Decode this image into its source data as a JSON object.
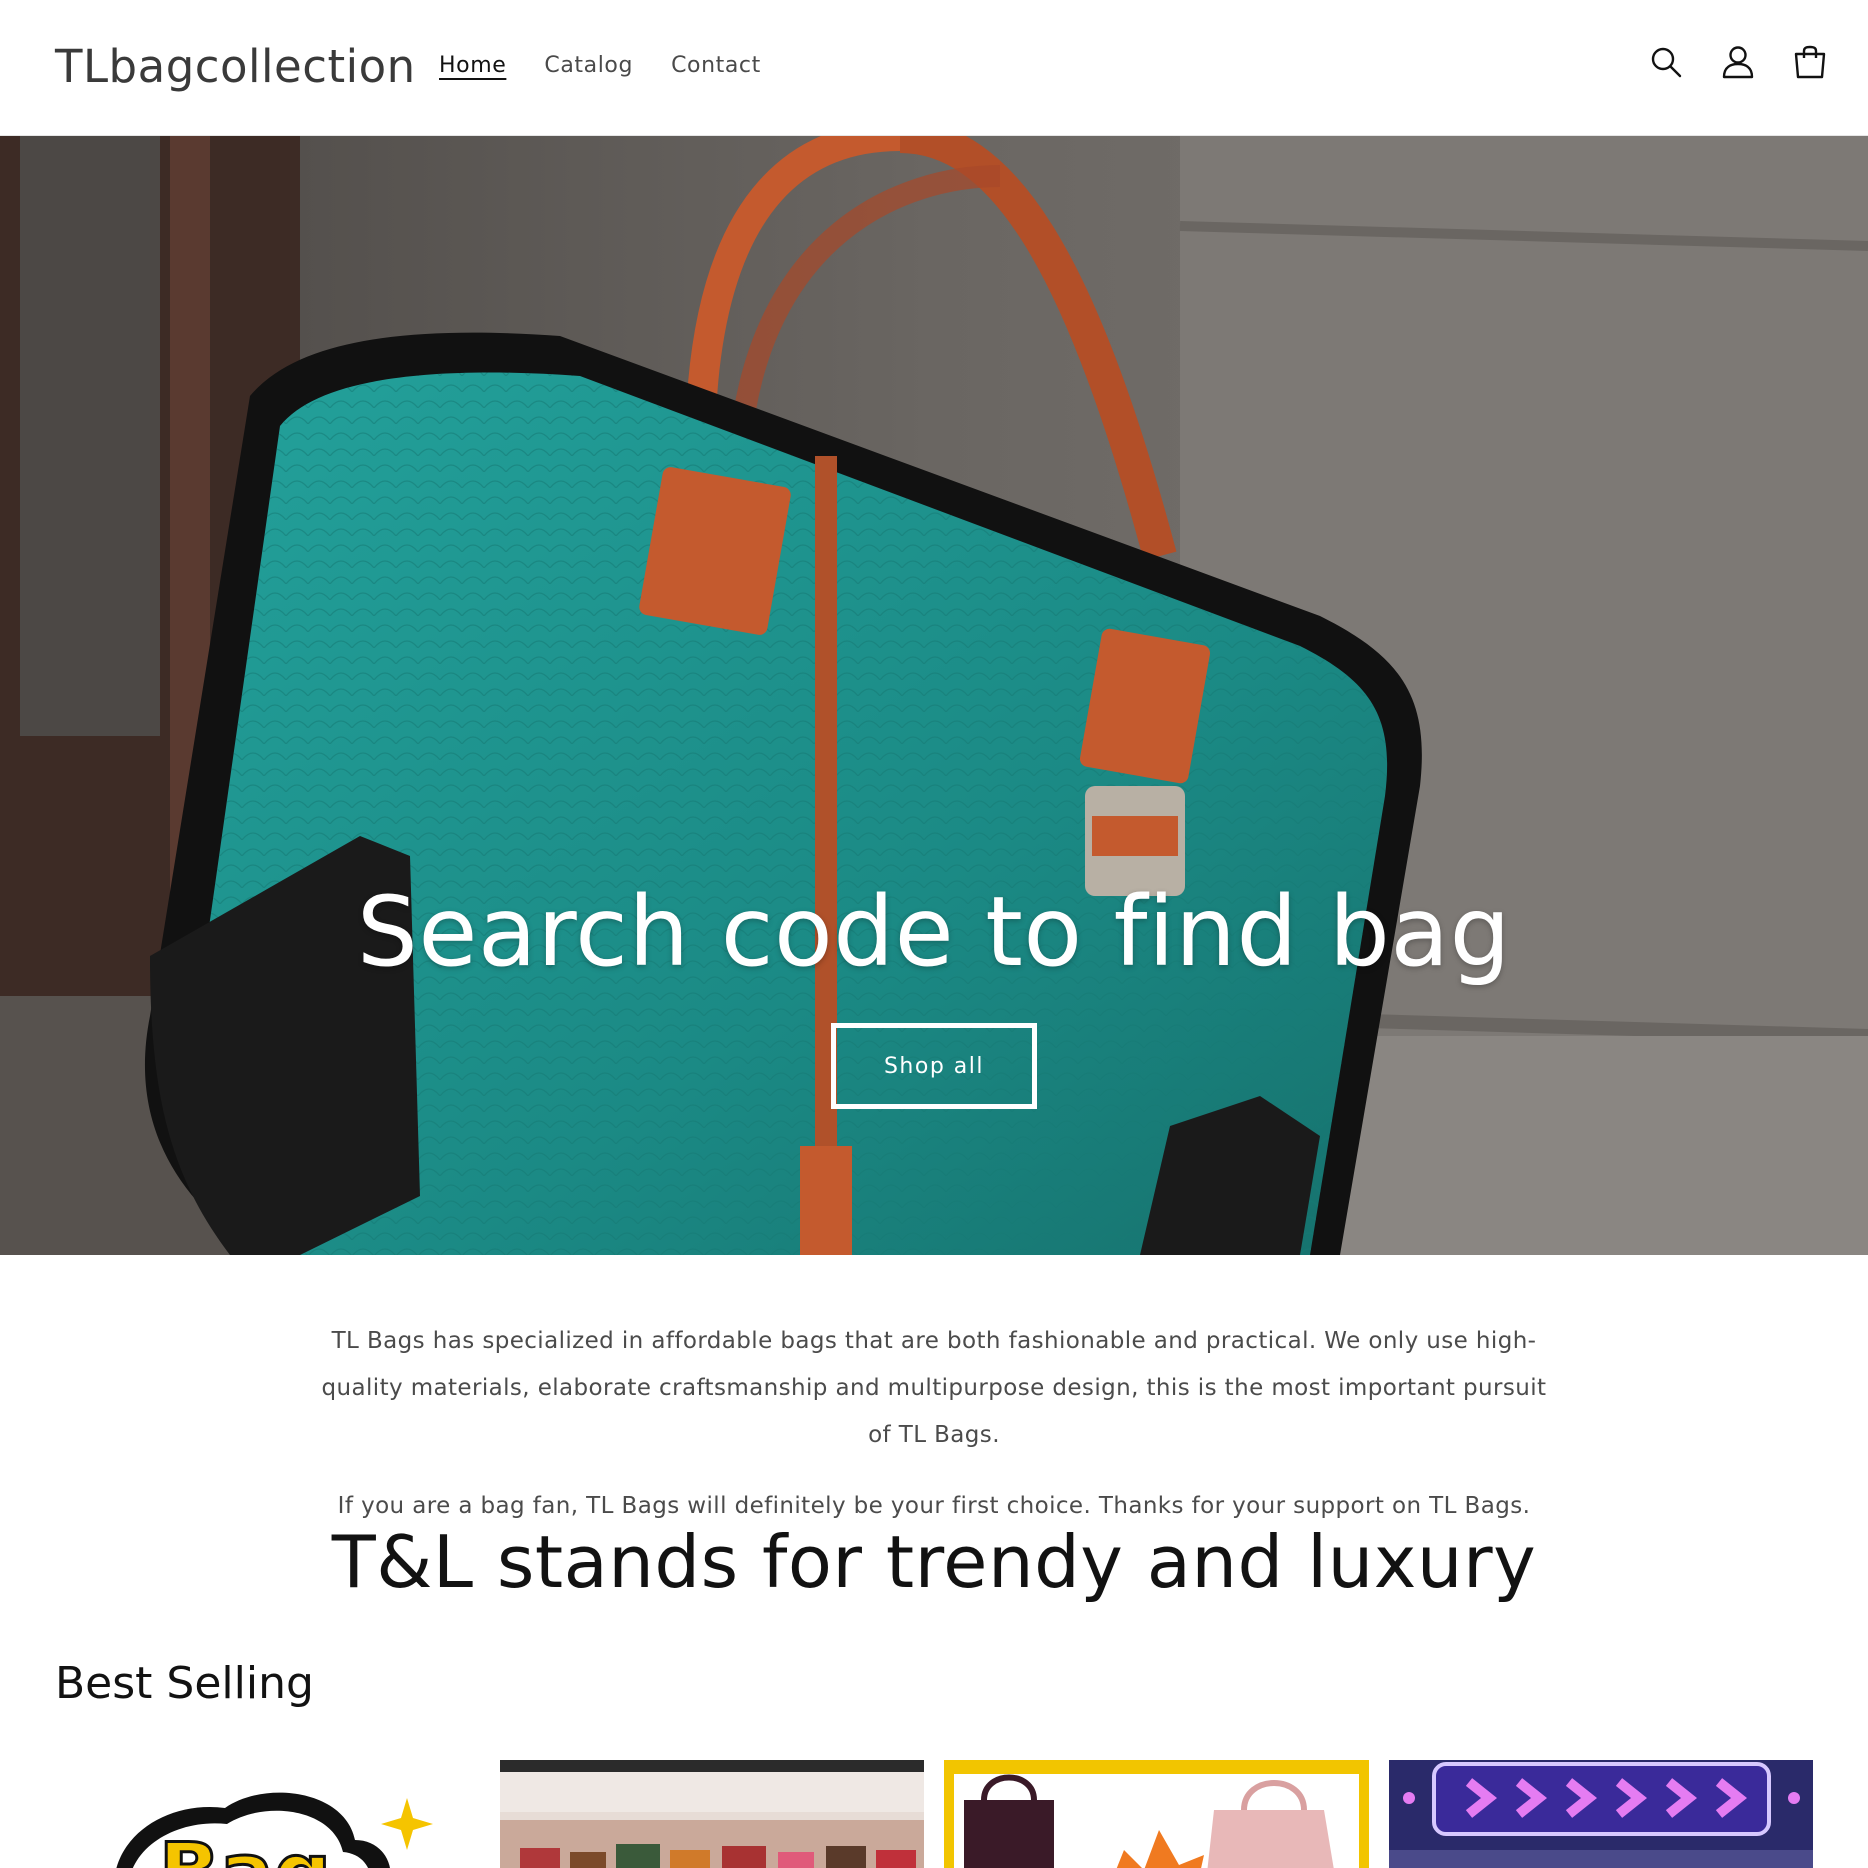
{
  "header": {
    "logo": "TLbagcollection",
    "nav": [
      {
        "label": "Home",
        "active": true
      },
      {
        "label": "Catalog",
        "active": false
      },
      {
        "label": "Contact",
        "active": false
      }
    ],
    "icons": [
      "search-icon",
      "account-icon",
      "cart-icon"
    ]
  },
  "hero": {
    "heading": "Search code to find bag",
    "button": "Shop all"
  },
  "about": {
    "paragraph1": "TL Bags has specialized in affordable bags that are both fashionable and practical. We only use high-quality materials, elaborate craftsmanship and multipurpose design, this is the most important pursuit of TL Bags.",
    "paragraph2": "If you are a bag fan, TL Bags will definitely be your first choice. Thanks for your support on TL Bags."
  },
  "tagline": "T&L stands for trendy and luxury",
  "best_selling": {
    "title": "Best Selling",
    "first_card_text": "Bag"
  },
  "colors": {
    "text": "#121212",
    "muted": "#4b4b4b",
    "bag_teal": "#1f8a86",
    "strap_orange": "#c45a2e"
  }
}
